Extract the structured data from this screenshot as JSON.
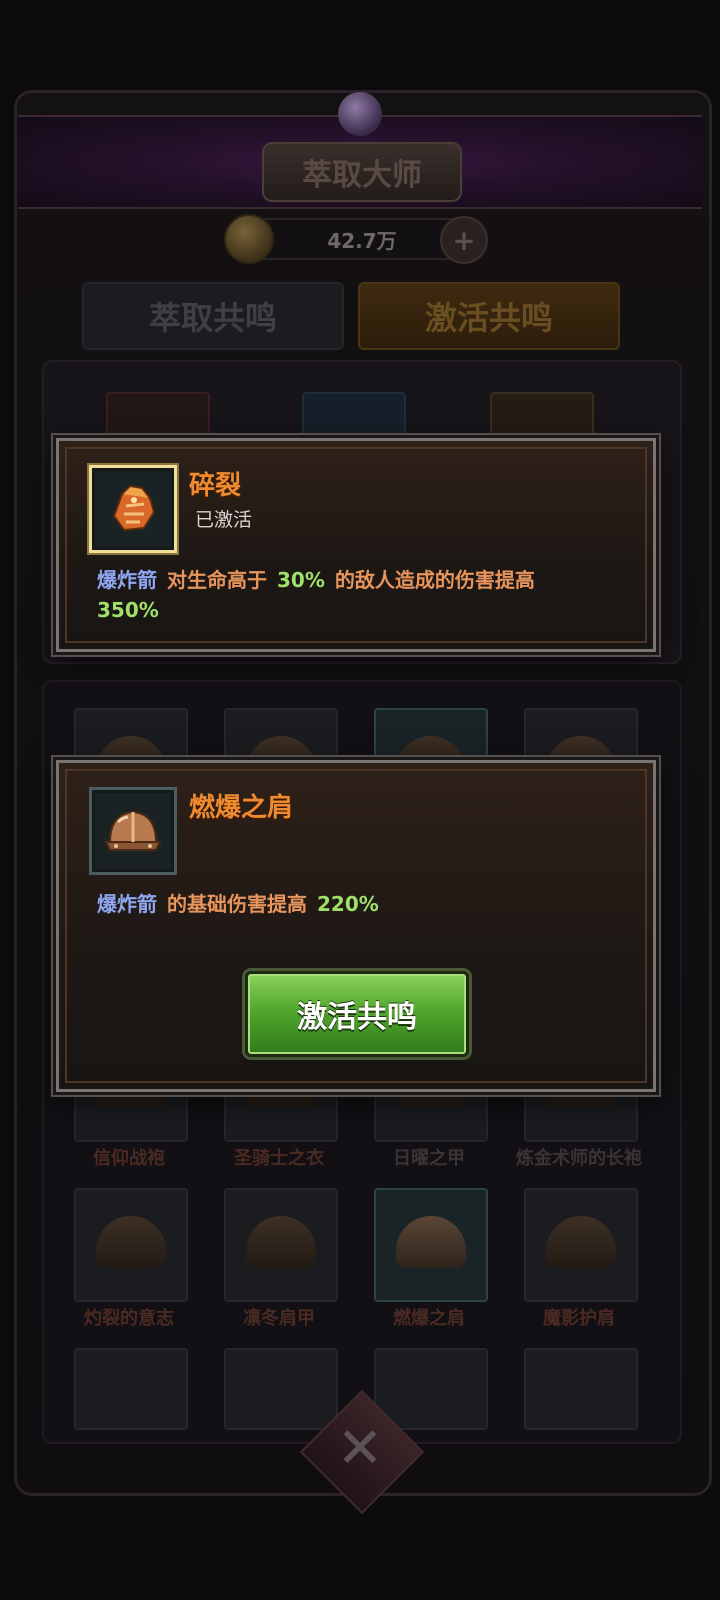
{
  "header": {
    "title": "萃取大师",
    "currency": "42.7万"
  },
  "tabs": [
    {
      "label": "萃取共鸣",
      "active": false
    },
    {
      "label": "激活共鸣",
      "active": true
    }
  ],
  "grid": {
    "row1_labels": [
      "信仰战袍",
      "圣骑士之衣",
      "日曜之甲",
      "炼金术师的长袍"
    ],
    "row2_labels": [
      "灼裂的意志",
      "凛冬肩甲",
      "燃爆之肩",
      "魔影护肩"
    ]
  },
  "popup_active": {
    "title": "碎裂",
    "status": "已激活",
    "icon": "gauntlet-icon",
    "desc_keyword": "爆炸箭",
    "desc_part1": "对生命高于",
    "desc_value1": "30%",
    "desc_part2": "的敌人造成的伤害提高",
    "desc_value2": "350%"
  },
  "popup_inactive": {
    "title": "燃爆之肩",
    "icon": "helmet-icon",
    "desc_keyword": "爆炸箭",
    "desc_part1": "的基础伤害提高",
    "desc_value1": "220%",
    "button_label": "激活共鸣"
  },
  "colors": {
    "title_orange": "#f08a2e",
    "keyword_blue": "#8ea6f0",
    "value_green": "#9fe06a",
    "button_green": "#52a82e"
  }
}
